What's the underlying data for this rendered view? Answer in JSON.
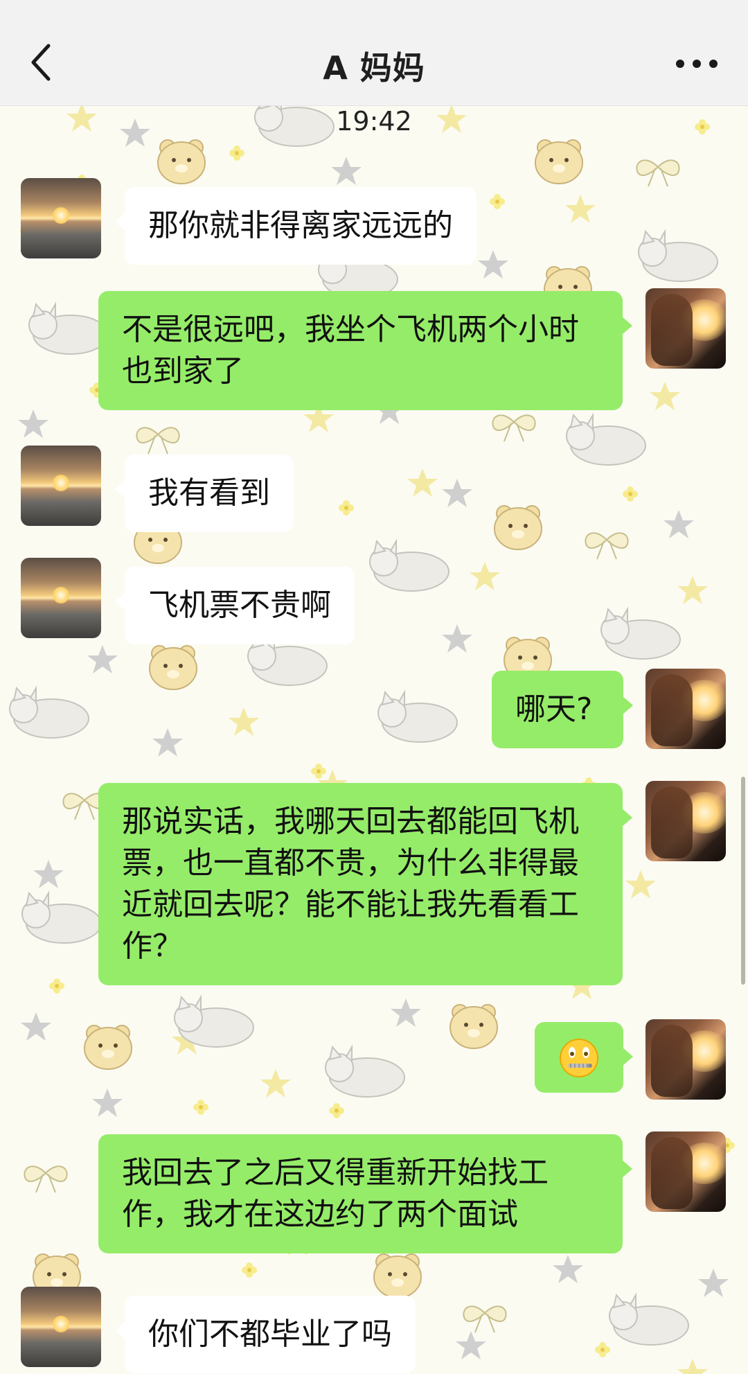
{
  "header": {
    "title": "A 妈妈",
    "back_icon": "chevron-left-icon",
    "more_icon": "more-horizontal-icon"
  },
  "chat": {
    "timestamp": "19:42",
    "messages": [
      {
        "side": "in",
        "text": "那你就非得离家远远的"
      },
      {
        "side": "out",
        "text": "不是很远吧，我坐个飞机两个小时也到家了"
      },
      {
        "side": "in",
        "text": "我有看到"
      },
      {
        "side": "in",
        "text": "飞机票不贵啊"
      },
      {
        "side": "out",
        "text": "哪天?"
      },
      {
        "side": "out",
        "text": "那说实话，我哪天回去都能回飞机票，也一直都不贵，为什么非得最近就回去呢？能不能让我先看看工作？"
      },
      {
        "side": "out",
        "emoji": "zipper-mouth-face-emoji"
      },
      {
        "side": "out",
        "text": "我回去了之后又得重新开始找工作，我才在这边约了两个面试"
      },
      {
        "side": "in",
        "text": "你们不都毕业了吗"
      }
    ]
  },
  "colors": {
    "outgoing_bubble": "#95ec69",
    "incoming_bubble": "#ffffff",
    "topbar_bg": "#f2f2f2"
  }
}
